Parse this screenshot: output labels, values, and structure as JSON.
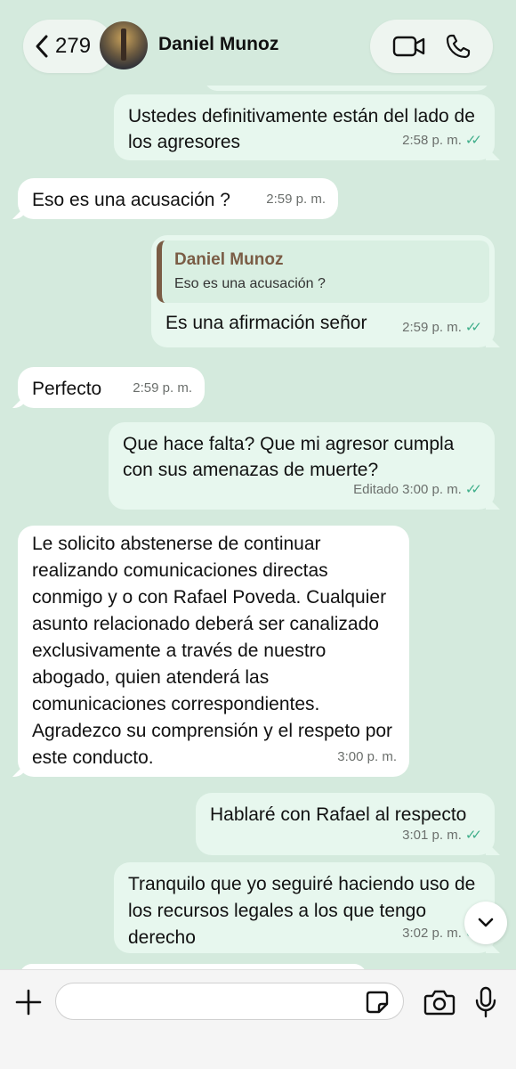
{
  "header": {
    "back_count": "279",
    "contact_name": "Daniel Munoz"
  },
  "messages": [
    {
      "dir": "out",
      "text": "Ustedes definitivamente están del lado de los agresores",
      "time": "2:58 p. m.",
      "read": true
    },
    {
      "dir": "in",
      "text": "Eso es una acusación ?",
      "time": "2:59 p. m."
    },
    {
      "dir": "out",
      "quote_name": "Daniel Munoz",
      "quote_text": "Eso es una acusación ?",
      "text": "Es una afirmación señor",
      "time": "2:59 p. m.",
      "read": true
    },
    {
      "dir": "in",
      "text": "Perfecto",
      "time": "2:59 p. m."
    },
    {
      "dir": "out",
      "text": "Que hace falta? Que mi agresor cumpla con sus amenazas de muerte?",
      "time": "Editado 3:00 p. m.",
      "read": true
    },
    {
      "dir": "in",
      "text": "Le solicito abstenerse de continuar realizando comunicaciones directas conmigo y o con Rafael Poveda. Cualquier asunto relacionado deberá ser canalizado exclusivamente a través de nuestro abogado, quien atenderá las comunicaciones correspondientes. Agradezco su comprensión y el respeto por este conducto.",
      "time": "3:00 p. m."
    },
    {
      "dir": "out",
      "text": "Hablaré con Rafael al respecto",
      "time": "3:01 p. m.",
      "read": true
    },
    {
      "dir": "out",
      "text": "Tranquilo que yo seguiré haciendo uso de los recursos legales a los que tengo derecho",
      "time": "3:02 p. m.",
      "read": true
    }
  ],
  "composer": {
    "placeholder": ""
  },
  "colors": {
    "background": "#d4eadd",
    "outgoing_bubble": "#e7f7ee",
    "incoming_bubble": "#ffffff",
    "read_ticks": "#3fae8a",
    "quote_accent": "#7a5c45"
  },
  "icons": [
    "back-chevron-icon",
    "video-call-icon",
    "phone-icon",
    "chevron-down-icon",
    "plus-icon",
    "sticker-icon",
    "camera-icon",
    "microphone-icon"
  ]
}
